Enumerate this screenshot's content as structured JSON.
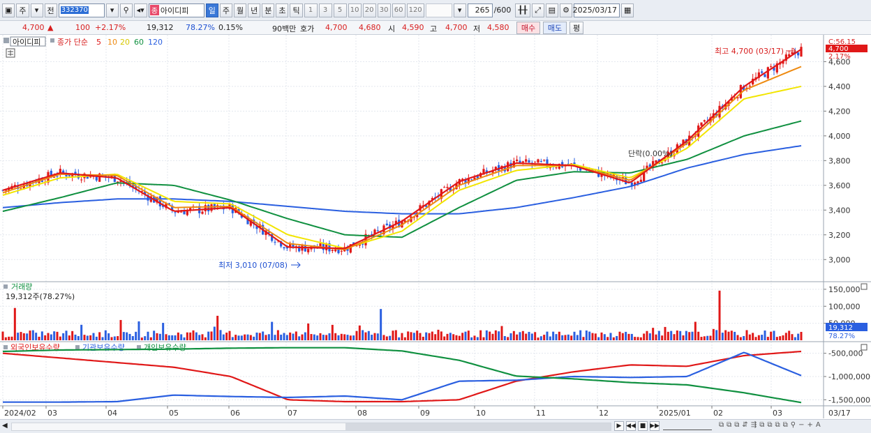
{
  "toolbar": {
    "type_label": "주",
    "prev_label": "전",
    "code": "332370",
    "stock_tag": "종",
    "stock_name": "아이디피",
    "periods": [
      "일",
      "주",
      "월",
      "년",
      "분",
      "초",
      "틱"
    ],
    "active_period": "일",
    "intervals": [
      "1",
      "3",
      "5",
      "10",
      "20",
      "30",
      "60",
      "120"
    ],
    "count": "265",
    "count_total": "/600",
    "date": "2025/03/17"
  },
  "quote": {
    "price": "4,700",
    "up_symbol": "▲",
    "change": "100",
    "change_pct": "+2.17%",
    "volume": "19,312",
    "vol_ratio": "78.27%",
    "turnover": "0.15%",
    "amount": "90백만",
    "ask_label": "호가",
    "ask1": "4,700",
    "ask2": "4,680",
    "open_label": "시",
    "open": "4,590",
    "high_label": "고",
    "high": "4,700",
    "low_label": "저",
    "low": "4,580",
    "buy_label": "매수",
    "sell_label": "매도",
    "avg_label": "평"
  },
  "price_legend": {
    "name": "아이디피",
    "prefix": "종가 단순",
    "periods": [
      "5",
      "10",
      "20",
      "60",
      "120"
    ],
    "colors": [
      "#e01818",
      "#ee8a10",
      "#f2e500",
      "#109040",
      "#2a5fe0"
    ]
  },
  "price_panel": {
    "right_labels": [
      "C:56.15",
      "4,700",
      "2.17%"
    ],
    "max_note": "최고 4,700 (03/17)",
    "min_note": "최저 3,010 (07/08)",
    "mid_note": "단락(0.00%)"
  },
  "volume_panel": {
    "title": "거래량",
    "subtitle": "19,312주(78.27%)",
    "last_value": "19,312",
    "last_pct": "78.27%"
  },
  "holding_panel": {
    "legend": [
      "외국인보유수량",
      "기관보유수량",
      "개인보유수량"
    ],
    "colors": [
      "#e01818",
      "#2a5fe0",
      "#109040"
    ]
  },
  "x_axis": {
    "labels": [
      "2024/02",
      "03",
      "04",
      "05",
      "06",
      "07",
      "08",
      "09",
      "10",
      "11",
      "12",
      "2025/01",
      "02",
      "03"
    ],
    "end_label": "03/17"
  },
  "chart_data": [
    {
      "type": "candlestick",
      "title": "아이디피",
      "ylim": [
        2900,
        4760
      ],
      "y_ticks": [
        3000,
        3200,
        3400,
        3600,
        3800,
        4000,
        4200,
        4400,
        4600
      ],
      "y_tick_labels": [
        "3,000",
        "3,200",
        "3,400",
        "3,600",
        "3,800",
        "4,000",
        "4,200",
        "4,400",
        "4,600"
      ],
      "x": [
        "2024/02",
        "03",
        "04",
        "05",
        "06",
        "07",
        "08",
        "09",
        "10",
        "11",
        "12",
        "2025/01",
        "02",
        "03/17"
      ],
      "series": [
        {
          "name": "5",
          "values": [
            3560,
            3700,
            3660,
            3390,
            3420,
            3100,
            3090,
            3310,
            3630,
            3780,
            3760,
            3620,
            3960,
            4400,
            4700
          ]
        },
        {
          "name": "10",
          "values": [
            3540,
            3690,
            3680,
            3420,
            3430,
            3130,
            3080,
            3280,
            3600,
            3760,
            3760,
            3640,
            3940,
            4370,
            4560
          ]
        },
        {
          "name": "20",
          "values": [
            3520,
            3660,
            3690,
            3470,
            3450,
            3200,
            3090,
            3230,
            3560,
            3720,
            3770,
            3660,
            3900,
            4300,
            4400
          ]
        },
        {
          "name": "60",
          "values": [
            3390,
            3500,
            3620,
            3600,
            3480,
            3330,
            3200,
            3180,
            3420,
            3640,
            3710,
            3700,
            3810,
            4000,
            4120
          ]
        },
        {
          "name": "120",
          "values": [
            3420,
            3460,
            3490,
            3490,
            3470,
            3430,
            3390,
            3370,
            3370,
            3420,
            3500,
            3590,
            3740,
            3850,
            3920
          ]
        }
      ],
      "annotations": [
        "최고 4,700 (03/17)",
        "최저 3,010 (07/08)"
      ]
    },
    {
      "type": "bar",
      "title": "거래량",
      "ylim": [
        0,
        160000
      ],
      "y_ticks": [
        50000,
        100000,
        150000
      ],
      "y_tick_labels": [
        "50,000",
        "100,000",
        "150,000"
      ],
      "highlights": [
        {
          "x": "2024/02",
          "value": 95000
        },
        {
          "x": "06",
          "value": 72000
        },
        {
          "x": "08",
          "value": 92000
        },
        {
          "x": "2025/02",
          "value": 146000
        },
        {
          "x": "03/17",
          "value": 19312
        }
      ]
    },
    {
      "type": "line",
      "title": "보유수량",
      "ylim": [
        -1600000,
        -400000
      ],
      "y_ticks": [
        -500000,
        -1000000,
        -1500000
      ],
      "y_tick_labels": [
        "-500,000",
        "-1,000,000",
        "-1,500,000"
      ],
      "x": [
        "2024/02",
        "03",
        "04",
        "05",
        "06",
        "07",
        "08",
        "09",
        "10",
        "11",
        "12",
        "2025/01",
        "02",
        "03/17"
      ],
      "series": [
        {
          "name": "외국인보유수량",
          "values": [
            -500000,
            -600000,
            -700000,
            -800000,
            -1000000,
            -1500000,
            -1540000,
            -1540000,
            -1500000,
            -1100000,
            -900000,
            -750000,
            -780000,
            -550000,
            -460000
          ]
        },
        {
          "name": "기관보유수량",
          "values": [
            -1550000,
            -1550000,
            -1540000,
            -1400000,
            -1430000,
            -1450000,
            -1420000,
            -1500000,
            -1100000,
            -1080000,
            -1000000,
            -1020000,
            -1000000,
            -480000,
            -980000
          ]
        },
        {
          "name": "개인보유수량",
          "values": [
            -460000,
            -430000,
            -420000,
            -410000,
            -390000,
            -380000,
            -380000,
            -450000,
            -650000,
            -990000,
            -1050000,
            -1130000,
            -1180000,
            -1350000,
            -1560000
          ]
        }
      ]
    }
  ]
}
